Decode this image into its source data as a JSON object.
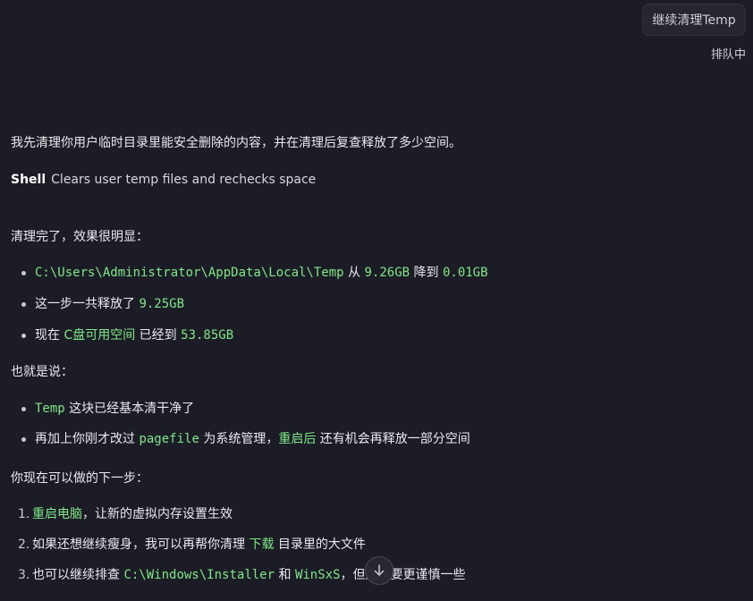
{
  "queue": {
    "card_label": "继续清理Temp",
    "status": "排队中"
  },
  "intro": "我先清理你用户临时目录里能安全删除的内容，并在清理后复查释放了多少空间。",
  "shell": {
    "label": "Shell",
    "description": "Clears user temp files and rechecks space"
  },
  "section1": {
    "heading": "清理完了，效果很明显：",
    "item1": {
      "path": "C:\\Users\\Administrator\\AppData\\Local\\Temp",
      "t1": " 从 ",
      "from": "9.26GB",
      "t2": " 降到 ",
      "to": "0.01GB"
    },
    "item2": {
      "text": "这一步一共释放了 ",
      "amount": "9.25GB"
    },
    "item3": {
      "t1": "现在 ",
      "drive": "C盘可用空间",
      "t2": " 已经到 ",
      "amount": "53.85GB"
    }
  },
  "section2": {
    "heading": "也就是说：",
    "item1": {
      "code": "Temp",
      "text": " 这块已经基本清干净了"
    },
    "item2": {
      "t1": "再加上你刚才改过 ",
      "code": "pagefile",
      "t2": " 为系统管理，",
      "green": "重启后",
      "t3": " 还有机会再释放一部分空间"
    }
  },
  "section3": {
    "heading": "你现在可以做的下一步：",
    "item1": {
      "num": "1.",
      "green": "重启电脑",
      "text": "，让新的虚拟内存设置生效"
    },
    "item2": {
      "num": "2.",
      "t1": "如果还想继续瘦身，我可以再帮你清理 ",
      "green": "下载",
      "t2": " 目录里的大文件"
    },
    "item3": {
      "num": "3.",
      "t1": "也可以继续排查 ",
      "code1": "C:\\Windows\\Installer",
      "t2": " 和 ",
      "code2": "WinSxS",
      "t3": "，但这",
      "t4": "块要更谨慎一些"
    }
  },
  "colors": {
    "background": "#1c1c26",
    "accent_green": "#7ee787"
  },
  "icons": {
    "scroll_down": "arrow-down-icon"
  }
}
